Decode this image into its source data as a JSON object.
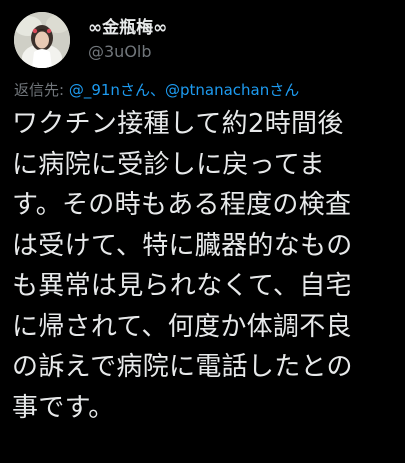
{
  "author": {
    "display_name": "∞金瓶梅∞",
    "handle": "@3uOlb",
    "avatar_icon": "profile-photo-avatar"
  },
  "reply": {
    "prefix": "返信先:",
    "mention_1": "@_91nさん",
    "separator": "、",
    "mention_2": "@ptnanachanさん"
  },
  "tweet": {
    "lines": [
      "ワクチン接種して約2時間後",
      "に病院に受診しに戻ってま",
      "す。その時もある程度の検査",
      "は受けて、特に臓器的なもの",
      "も異常は見られなくて、自宅",
      "に帰されて、何度か体調不良",
      "の訴えで病院に電話したとの",
      "事です。"
    ]
  },
  "colors": {
    "background": "#000000",
    "text": "#e7e9ea",
    "secondary": "#71767b",
    "accent": "#1d9bf0"
  }
}
